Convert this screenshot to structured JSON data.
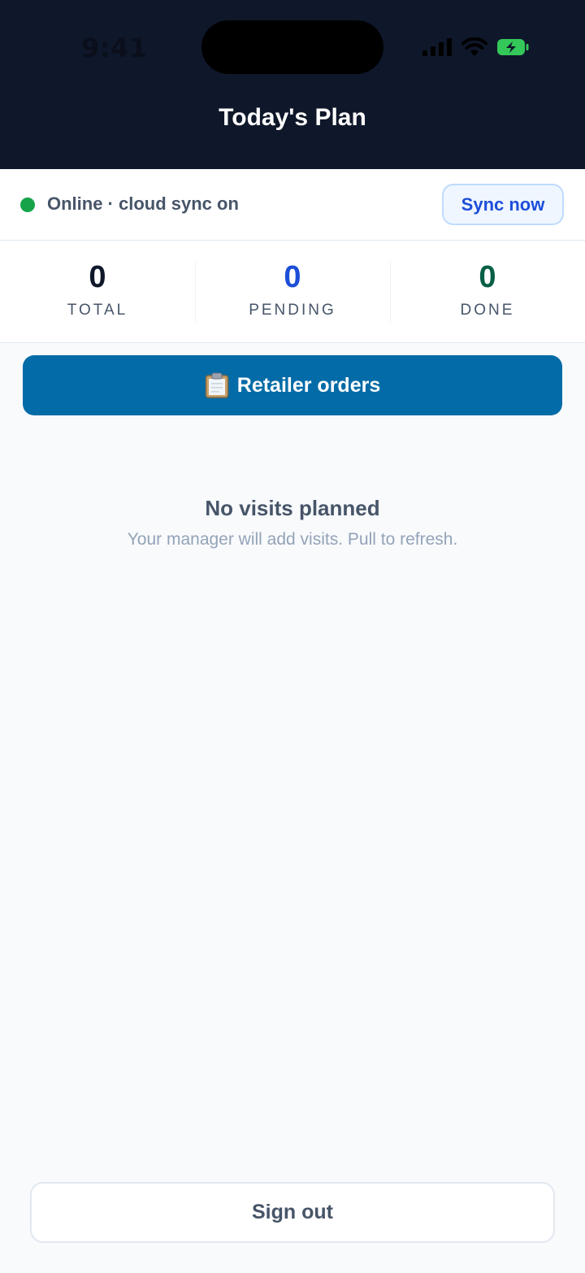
{
  "status_bar": {
    "time": "9:41"
  },
  "header": {
    "title": "Today's Plan"
  },
  "sync_bar": {
    "status_text": "Online · cloud sync on",
    "sync_button_label": "Sync now"
  },
  "stats": [
    {
      "value": "0",
      "label": "TOTAL",
      "color": "#0f172a"
    },
    {
      "value": "0",
      "label": "PENDING",
      "color": "#1d4ed8"
    },
    {
      "value": "0",
      "label": "DONE",
      "color": "#065f46"
    }
  ],
  "orders_button": {
    "icon": "clipboard-icon",
    "label": "Retailer orders"
  },
  "empty_state": {
    "title": "No visits planned",
    "subtitle": "Your manager will add visits. Pull to refresh."
  },
  "footer": {
    "signout_label": "Sign out"
  },
  "colors": {
    "header_bg": "#0f172a",
    "online_dot": "#16a34a",
    "primary_button": "#036ba7",
    "sync_button_text": "#1d4ed8",
    "battery": "#34c759"
  }
}
